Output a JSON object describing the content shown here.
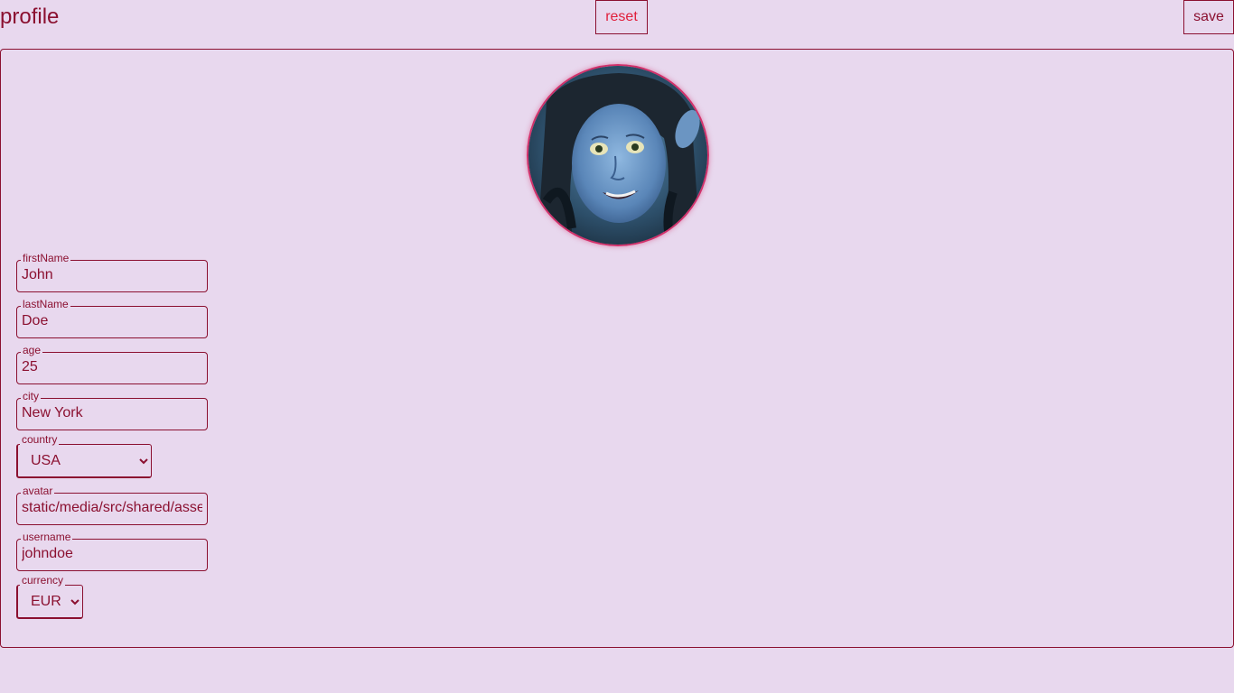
{
  "header": {
    "title": "profile",
    "reset_label": "reset",
    "save_label": "save"
  },
  "form": {
    "firstName": {
      "label": "firstName",
      "value": "John"
    },
    "lastName": {
      "label": "lastName",
      "value": "Doe"
    },
    "age": {
      "label": "age",
      "value": "25"
    },
    "city": {
      "label": "city",
      "value": "New York"
    },
    "country": {
      "label": "country",
      "value": "USA"
    },
    "avatar": {
      "label": "avatar",
      "value": "static/media/src/shared/asse"
    },
    "username": {
      "label": "username",
      "value": "johndoe"
    },
    "currency": {
      "label": "currency",
      "value": "EUR"
    }
  },
  "colors": {
    "background": "#e8d8ee",
    "primary": "#8b1030",
    "reset": "#e0203c",
    "avatar_ring": "#d2306a"
  }
}
